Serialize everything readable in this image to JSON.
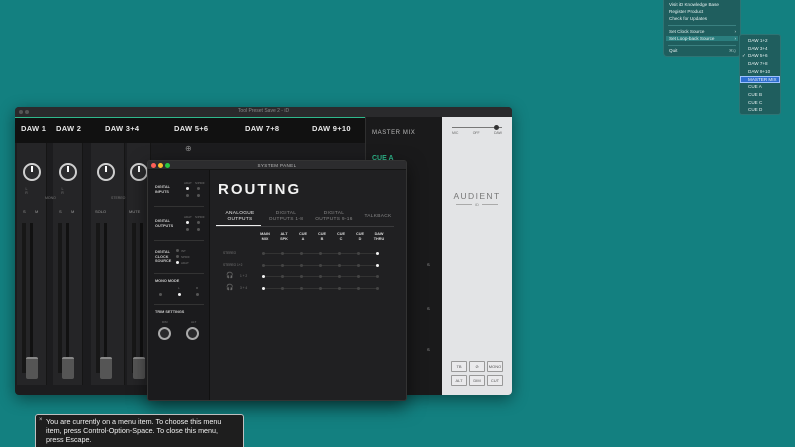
{
  "mixer": {
    "title": "Tool Preset Save 2 - iD",
    "tabs": [
      "DAW 1",
      "DAW 2",
      "DAW 3+4",
      "DAW 5+6",
      "DAW 7+8",
      "DAW 9+10"
    ],
    "master_mix_label": "MASTER MIX",
    "cue_label": "CUE A",
    "strip_buttons": [
      "S",
      "M"
    ],
    "solo_label": "SOLO",
    "mute_label": "MUTE",
    "stereo_label": "STEREO",
    "mono_label": "MONO",
    "lr_label": "L   R",
    "fader_labels": [
      "-18",
      "-18",
      "-18"
    ]
  },
  "audient_panel": {
    "logo": "AUDIENT",
    "logo_sub": "iD",
    "slider_labels": [
      "MIC",
      "OFF",
      "DAW"
    ],
    "buttons_row1": [
      "TB",
      "⊘",
      "MONO"
    ],
    "buttons_row2": [
      "ALT",
      "DIM",
      "CUT"
    ],
    "side_letters": [
      "S",
      "S",
      "S",
      "S"
    ]
  },
  "system_panel": {
    "title": "SYSTEM PANEL",
    "digital_inputs_label": "DIGITAL INPUTS",
    "digital_outputs_label": "DIGITAL OUTPUTS",
    "adat_label": "ADAT",
    "spdif_label": "S/PDIF",
    "clock_label": "DIGITAL CLOCK SOURCE",
    "clock_options": [
      "INT",
      "SPDIF",
      "ADAT"
    ],
    "mono_mode_label": "MONO MODE",
    "mono_lr": [
      "L",
      "R"
    ],
    "trim_label": "TRIM SETTINGS",
    "trim_knobs": [
      "DIM",
      "ALT"
    ],
    "routing_title": "ROUTING",
    "tabs": [
      {
        "l1": "ANALOGUE",
        "l2": "OUTPUTS"
      },
      {
        "l1": "DIGITAL",
        "l2": "OUTPUTS 1-8"
      },
      {
        "l1": "DIGITAL",
        "l2": "OUTPUTS 9-16"
      },
      {
        "l1": "TALKBACK",
        "l2": ""
      }
    ],
    "columns": [
      {
        "l1": "MAIN",
        "l2": "MIX"
      },
      {
        "l1": "ALT",
        "l2": "SPK"
      },
      {
        "l1": "CUE",
        "l2": "A"
      },
      {
        "l1": "CUE",
        "l2": "B"
      },
      {
        "l1": "CUE",
        "l2": "C"
      },
      {
        "l1": "CUE",
        "l2": "D"
      },
      {
        "l1": "DAW",
        "l2": "THRU"
      }
    ],
    "rows": [
      {
        "label": "STEREO",
        "active": 6
      },
      {
        "label": "STEREO 1+2",
        "active": 6
      },
      {
        "label": "1 + 2",
        "active": 0
      },
      {
        "label": "3 + 4",
        "active": 0
      }
    ]
  },
  "menu": {
    "items": [
      "Visit iD Knowledge Base",
      "Register Product",
      "Check for Updates",
      "Set Clock Source",
      "Set Loop-back Source",
      "Quit"
    ],
    "quit_shortcut": "⌘Q"
  },
  "submenu": {
    "items": [
      "DAW 1+2",
      "DAW 3+4",
      "DAW 5+6",
      "DAW 7+8",
      "DAW 9+10",
      "MASTER MIX",
      "CUE A",
      "CUE B",
      "CUE C",
      "CUE D"
    ],
    "checked_index": 2,
    "selected_index": 5,
    "check_glyph": "✓"
  },
  "voiceover": {
    "close_glyph": "×",
    "text": "You are currently on a menu item. To choose this menu item, press Control-Option-Space. To close this menu, press Escape."
  },
  "colors": {
    "desktop": "#138080",
    "accent_green": "#2fb88c",
    "selection_blue": "#2f6fd0"
  }
}
